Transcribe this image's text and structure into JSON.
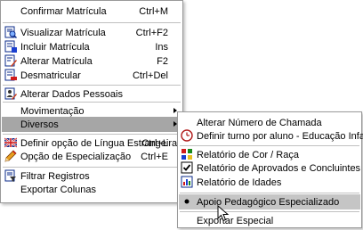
{
  "main_menu": {
    "items": [
      {
        "label": "Confirmar Matrícula",
        "shortcut": "Ctrl+M",
        "icon": "none"
      },
      {
        "label": "Visualizar Matrícula",
        "shortcut": "Ctrl+F2",
        "icon": "document-view-icon"
      },
      {
        "label": "Incluir Matrícula",
        "shortcut": "Ins",
        "icon": "document-add-icon"
      },
      {
        "label": "Alterar Matrícula",
        "shortcut": "F2",
        "icon": "document-edit-icon"
      },
      {
        "label": "Desmatricular",
        "shortcut": "Ctrl+Del",
        "icon": "document-remove-icon"
      },
      {
        "label": "Alterar Dados Pessoais",
        "shortcut": "",
        "icon": "person-edit-icon"
      },
      {
        "label": "Movimentação",
        "shortcut": "",
        "icon": "none"
      },
      {
        "label": "Diversos",
        "shortcut": "",
        "icon": "none"
      },
      {
        "label": "Definir opção de Língua Estrangeira",
        "shortcut": "Ctrl+L",
        "icon": "flag-icon"
      },
      {
        "label": "Opção de Especialização",
        "shortcut": "Ctrl+E",
        "icon": "pencil-icon"
      },
      {
        "label": "Filtrar Registros",
        "shortcut": "",
        "icon": "filter-icon"
      },
      {
        "label": "Exportar Colunas",
        "shortcut": "",
        "icon": "none"
      }
    ]
  },
  "sub_menu": {
    "items": [
      {
        "label": "Alterar Número de Chamada"
      },
      {
        "label": "Definir turno por aluno - Educação Infantil"
      },
      {
        "label": "Relatório de Cor / Raça"
      },
      {
        "label": "Relatório de Aprovados e Concluintes"
      },
      {
        "label": "Relatório de Idades"
      },
      {
        "label": "Apoio Pedagógico Especializado"
      },
      {
        "label": "Exportar Especial"
      }
    ]
  },
  "colors": {
    "highlight": "#a6a6a6",
    "separator": "#c0c0c0",
    "border": "#9a9a9a"
  }
}
